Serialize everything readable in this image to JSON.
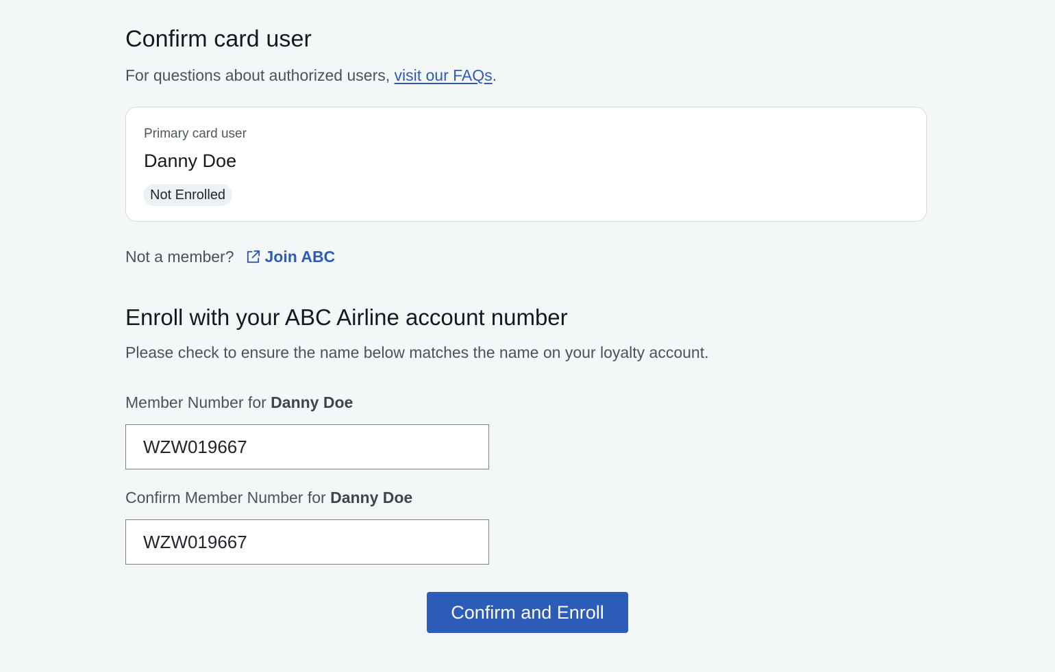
{
  "header": {
    "title": "Confirm card user",
    "faq_prefix": "For questions about authorized users, ",
    "faq_link": "visit our FAQs",
    "faq_suffix": "."
  },
  "card": {
    "label": "Primary card user",
    "name": "Danny Doe",
    "status": "Not Enrolled"
  },
  "membership": {
    "prompt": "Not a member?",
    "join_label": "Join ABC",
    "join_icon": "external-link-icon"
  },
  "enroll": {
    "title": "Enroll with your ABC Airline account number",
    "help": "Please check to ensure the name below matches the name on your loyalty account.",
    "member_number_label": "Member Number for ",
    "member_number_name": "Danny Doe",
    "member_number_value": "WZW019667",
    "confirm_label": "Confirm Member Number for ",
    "confirm_name": "Danny Doe",
    "confirm_value": "WZW019667",
    "submit_label": "Confirm and Enroll"
  },
  "colors": {
    "background": "#f4f7f8",
    "accent": "#2c5bb8",
    "text": "#15191e",
    "muted_text": "#4a535c",
    "badge_bg": "#eef1f4"
  }
}
